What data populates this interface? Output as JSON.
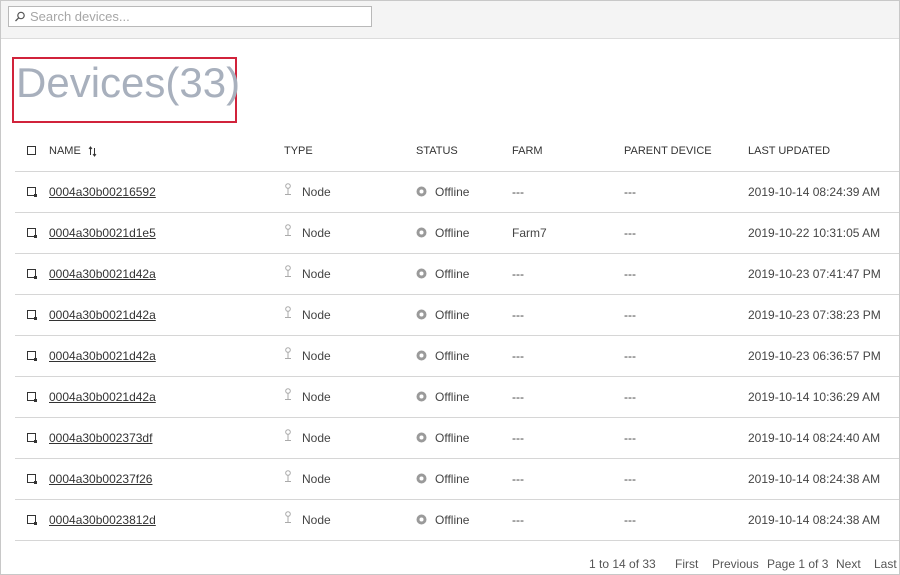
{
  "search": {
    "placeholder": "Search devices...",
    "value": "",
    "icon": "search-icon"
  },
  "page": {
    "title": "Devices(33)",
    "highlight_color": "#d1233b",
    "title_color": "#a8b0bd"
  },
  "table": {
    "columns": {
      "name": "NAME",
      "type": "TYPE",
      "status": "STATUS",
      "farm": "FARM",
      "parent": "PARENT DEVICE",
      "updated": "LAST UPDATED"
    },
    "rows": [
      {
        "name": "0004a30b00216592",
        "type": "Node",
        "status": "Offline",
        "farm": "---",
        "parent": "---",
        "updated": "2019-10-14 08:24:39 AM"
      },
      {
        "name": "0004a30b0021d1e5",
        "type": "Node",
        "status": "Offline",
        "farm": "Farm7",
        "parent": "---",
        "updated": "2019-10-22 10:31:05 AM"
      },
      {
        "name": "0004a30b0021d42a",
        "type": "Node",
        "status": "Offline",
        "farm": "---",
        "parent": "---",
        "updated": "2019-10-23 07:41:47 PM"
      },
      {
        "name": "0004a30b0021d42a",
        "type": "Node",
        "status": "Offline",
        "farm": "---",
        "parent": "---",
        "updated": "2019-10-23 07:38:23 PM"
      },
      {
        "name": "0004a30b0021d42a",
        "type": "Node",
        "status": "Offline",
        "farm": "---",
        "parent": "---",
        "updated": "2019-10-23 06:36:57 PM"
      },
      {
        "name": "0004a30b0021d42a",
        "type": "Node",
        "status": "Offline",
        "farm": "---",
        "parent": "---",
        "updated": "2019-10-14 10:36:29 AM"
      },
      {
        "name": "0004a30b002373df",
        "type": "Node",
        "status": "Offline",
        "farm": "---",
        "parent": "---",
        "updated": "2019-10-14 08:24:40 AM"
      },
      {
        "name": "0004a30b00237f26",
        "type": "Node",
        "status": "Offline",
        "farm": "---",
        "parent": "---",
        "updated": "2019-10-14 08:24:38 AM"
      },
      {
        "name": "0004a30b0023812d",
        "type": "Node",
        "status": "Offline",
        "farm": "---",
        "parent": "---",
        "updated": "2019-10-14 08:24:38 AM"
      }
    ]
  },
  "pagination": {
    "range": "1 to 14 of 33",
    "first": "First",
    "previous": "Previous",
    "page": "Page 1 of 3",
    "next": "Next",
    "last": "Last"
  }
}
